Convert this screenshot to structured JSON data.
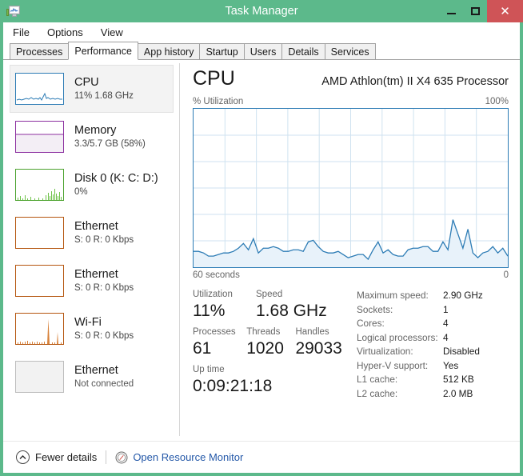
{
  "window": {
    "title": "Task Manager",
    "icon": "task-manager-icon",
    "minimize": "–",
    "maximize": "□",
    "close": "✕",
    "accent_color": "#5cb98b",
    "close_color": "#cf5457"
  },
  "menu": {
    "items": [
      {
        "label": "File"
      },
      {
        "label": "Options"
      },
      {
        "label": "View"
      }
    ]
  },
  "tabs": [
    {
      "label": "Processes",
      "active": false
    },
    {
      "label": "Performance",
      "active": true
    },
    {
      "label": "App history",
      "active": false
    },
    {
      "label": "Startup",
      "active": false
    },
    {
      "label": "Users",
      "active": false
    },
    {
      "label": "Details",
      "active": false
    },
    {
      "label": "Services",
      "active": false
    }
  ],
  "sidebar": {
    "items": [
      {
        "title": "CPU",
        "sub": "11% 1.68 GHz",
        "color": "#2d7cb5",
        "selected": true
      },
      {
        "title": "Memory",
        "sub": "3.3/5.7 GB (58%)",
        "color": "#8c30a0",
        "selected": false
      },
      {
        "title": "Disk 0 (K: C: D:)",
        "sub": "0%",
        "color": "#4ba22e",
        "selected": false
      },
      {
        "title": "Ethernet",
        "sub": "S: 0 R: 0 Kbps",
        "color": "#b5560f",
        "selected": false
      },
      {
        "title": "Ethernet",
        "sub": "S: 0 R: 0 Kbps",
        "color": "#b5560f",
        "selected": false
      },
      {
        "title": "Wi-Fi",
        "sub": "S: 0 R: 0 Kbps",
        "color": "#b5560f",
        "selected": false
      },
      {
        "title": "Ethernet",
        "sub": "Not connected",
        "color": "#999999",
        "selected": false
      }
    ]
  },
  "main": {
    "title": "CPU",
    "processor": "AMD Athlon(tm) II X4 635 Processor",
    "chart_axis_label": "% Utilization",
    "chart_max_label": "100%",
    "chart_time_left": "60 seconds",
    "chart_time_right": "0",
    "stats": [
      {
        "label": "Utilization",
        "value": "11%"
      },
      {
        "label": "Speed",
        "value": "1.68 GHz"
      },
      {
        "label": "Processes",
        "value": "61"
      },
      {
        "label": "Threads",
        "value": "1020"
      },
      {
        "label": "Handles",
        "value": "29033"
      },
      {
        "label": "Up time",
        "value": "0:09:21:18"
      }
    ],
    "specs": [
      {
        "label": "Maximum speed:",
        "value": "2.90 GHz"
      },
      {
        "label": "Sockets:",
        "value": "1"
      },
      {
        "label": "Cores:",
        "value": "4"
      },
      {
        "label": "Logical processors:",
        "value": "4"
      },
      {
        "label": "Virtualization:",
        "value": "Disabled"
      },
      {
        "label": "Hyper-V support:",
        "value": "Yes"
      },
      {
        "label": "L1 cache:",
        "value": "512 KB"
      },
      {
        "label": "L2 cache:",
        "value": "2.0 MB"
      }
    ]
  },
  "footer": {
    "fewer_details": "Fewer details",
    "open_resource_monitor": "Open Resource Monitor",
    "link_color": "#2458a8"
  },
  "chart_data": {
    "type": "area",
    "title": "CPU % Utilization over 60 seconds",
    "xlabel": "60 seconds",
    "ylabel": "% Utilization",
    "ylim": [
      0,
      100
    ],
    "xlim": [
      60,
      0
    ],
    "grid": true,
    "grid_cols": 10,
    "grid_rows": 6,
    "line_color": "#2d7cb5",
    "fill_color": "#e8f2fa",
    "values": [
      10,
      10,
      9,
      7,
      7,
      8,
      9,
      9,
      10,
      12,
      15,
      11,
      18,
      9,
      12,
      12,
      13,
      12,
      10,
      10,
      11,
      11,
      10,
      16,
      17,
      13,
      10,
      9,
      9,
      10,
      8,
      6,
      7,
      8,
      8,
      5,
      11,
      16,
      9,
      11,
      8,
      7,
      7,
      11,
      12,
      12,
      13,
      13,
      10,
      10,
      16,
      11,
      30,
      21,
      12,
      24,
      9,
      6,
      9,
      10,
      13,
      9,
      12,
      7
    ]
  }
}
